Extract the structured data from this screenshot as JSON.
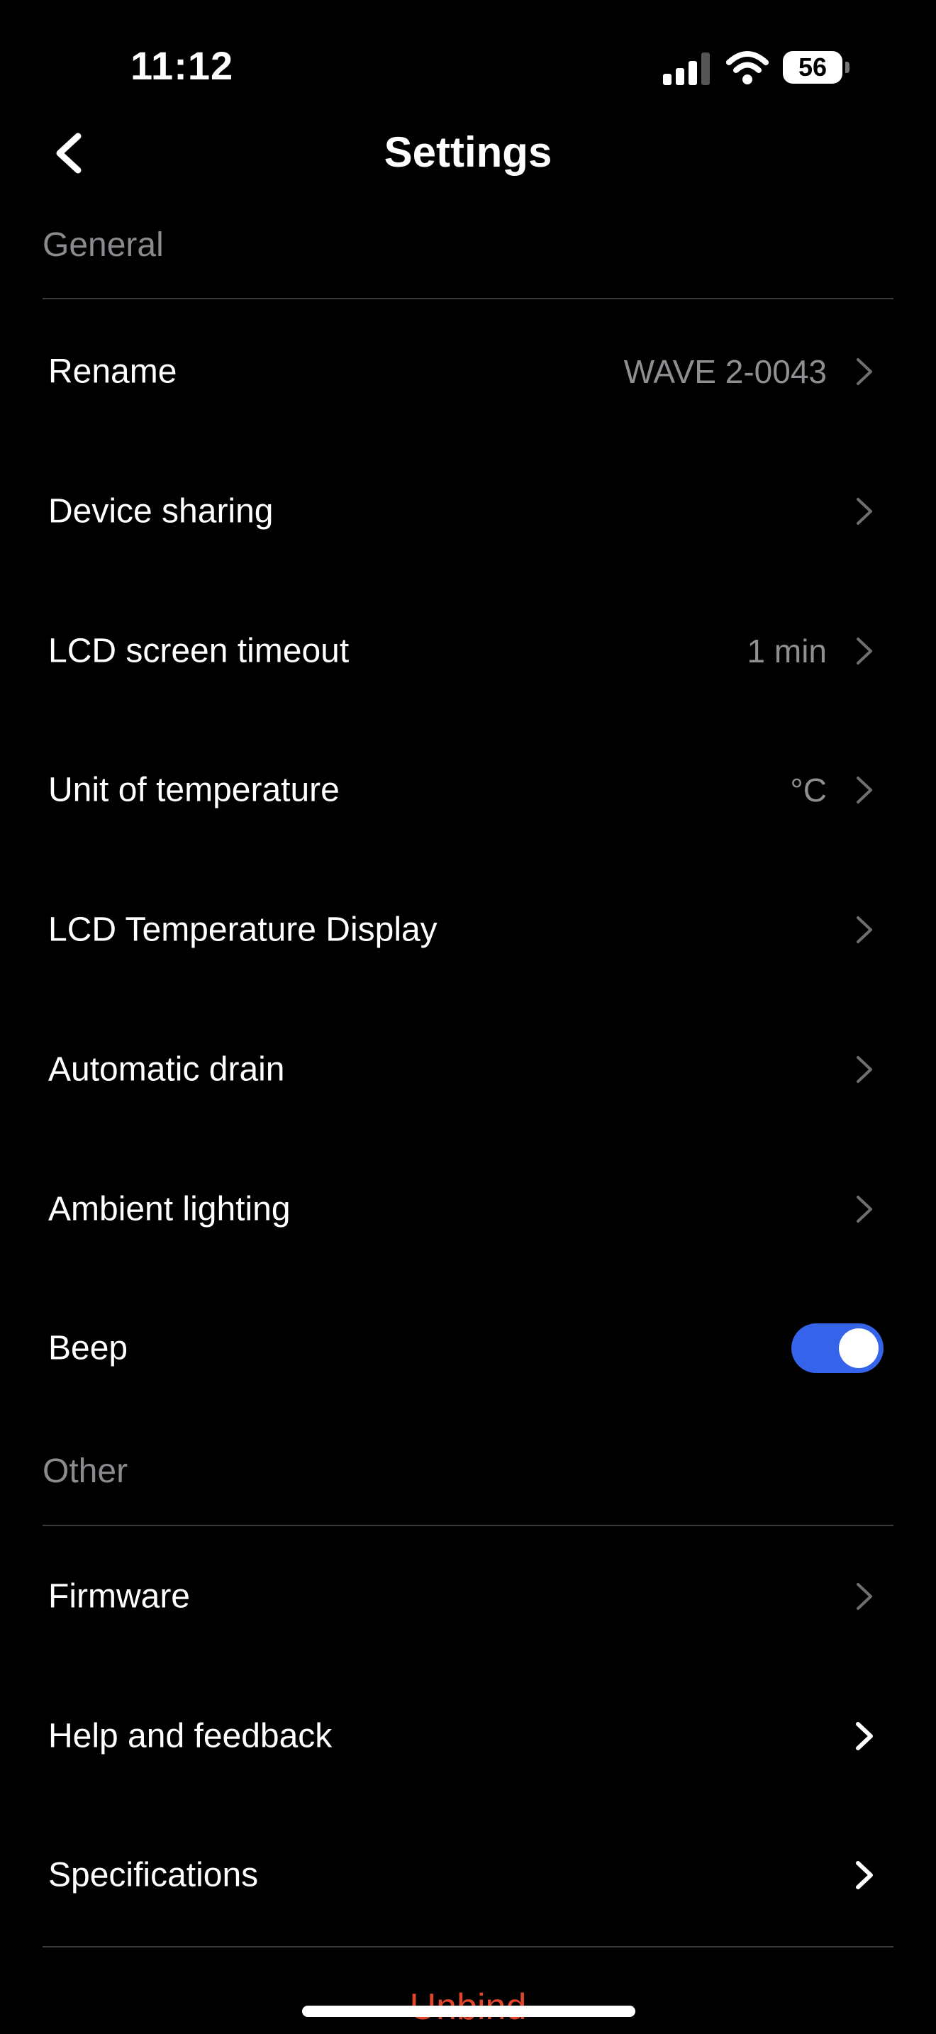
{
  "status": {
    "time": "11:12",
    "battery": "56",
    "icons": [
      "cellular-signal-icon",
      "wifi-icon",
      "battery-icon"
    ]
  },
  "nav": {
    "title": "Settings",
    "back_icon": "chevron-left-icon"
  },
  "sections": {
    "general": "General",
    "other": "Other"
  },
  "general_rows": [
    {
      "label": "Rename",
      "value": "WAVE 2-0043"
    },
    {
      "label": "Device sharing",
      "value": ""
    },
    {
      "label": "LCD screen timeout",
      "value": "1 min"
    },
    {
      "label": "Unit of temperature",
      "value": "°C"
    },
    {
      "label": "LCD Temperature Display",
      "value": ""
    },
    {
      "label": "Automatic drain",
      "value": ""
    },
    {
      "label": "Ambient lighting",
      "value": ""
    },
    {
      "label": "Beep",
      "toggle_on": true
    }
  ],
  "other_rows": [
    {
      "label": "Firmware"
    },
    {
      "label": "Help and feedback"
    },
    {
      "label": "Specifications"
    }
  ],
  "footer": {
    "unbind_label": "Unbind"
  },
  "colors": {
    "background": "#000000",
    "accent": "#3563e9",
    "muted": "#8e8e93",
    "danger": "#e0442b"
  }
}
